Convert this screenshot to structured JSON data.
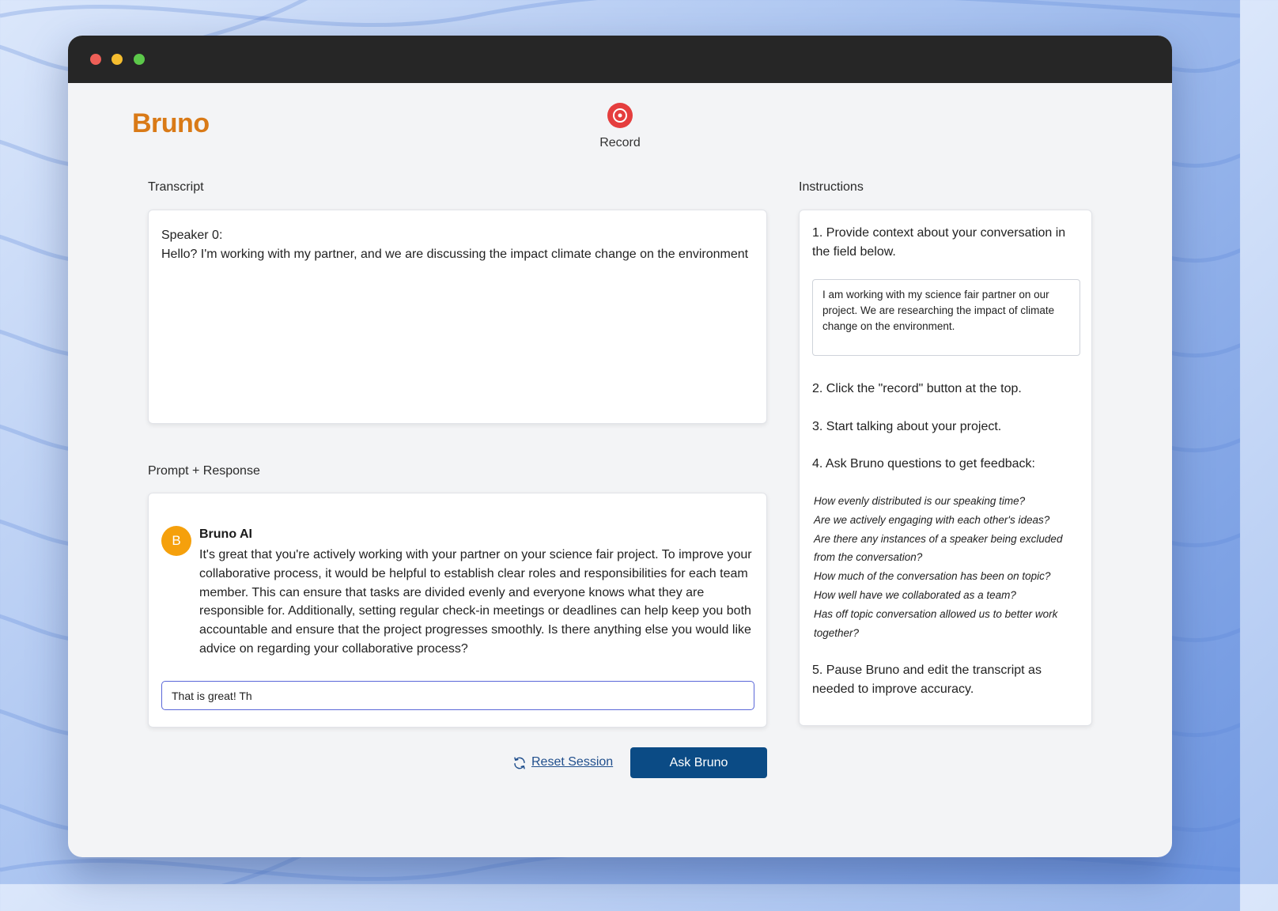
{
  "app": {
    "logo": "Bruno"
  },
  "record": {
    "label": "Record",
    "icon": "record-icon",
    "color": "#e53e3e"
  },
  "transcript": {
    "label": "Transcript",
    "speaker": "Speaker 0:",
    "text": "Hello? I'm working with my partner, and we are discussing the impact climate change on the environment"
  },
  "prompt": {
    "label": "Prompt + Response",
    "avatar_letter": "B",
    "ai_name": "Bruno AI",
    "response": "It's great that you're actively working with your partner on your science fair project. To improve your collaborative process, it would be helpful to establish clear roles and responsibilities for each team member. This can ensure that tasks are divided evenly and everyone knows what they are responsible for. Additionally, setting regular check-in meetings or deadlines can help keep you both accountable and ensure that the project progresses smoothly. Is there anything else you would like advice on regarding your collaborative process?",
    "input_value": "That is great! Th"
  },
  "actions": {
    "reset_label": "Reset Session",
    "ask_label": "Ask Bruno"
  },
  "instructions": {
    "label": "Instructions",
    "step1": "1. Provide context about your conversation in the field below.",
    "context_value": "I am working with my science fair partner on our project. We are researching the impact of climate change on the environment.",
    "step2": "2. Click the \"record\" button at the top.",
    "step3": "3. Start talking about your project.",
    "step4": "4. Ask Bruno questions to get feedback:",
    "questions": [
      "How evenly distributed is our speaking time?",
      "Are we actively engaging with each other's ideas?",
      "Are there any instances of a speaker being excluded from the conversation?",
      "How much of the conversation has been on topic?",
      "How well have we collaborated as a team?",
      "Has off topic conversation allowed us to better work together?"
    ],
    "step5": "5. Pause Bruno and edit the transcript as needed to improve accuracy."
  },
  "colors": {
    "brand": "#d97a17",
    "primary_button": "#0b4b85",
    "avatar": "#f5a00c",
    "input_focus": "#5a67d8"
  }
}
